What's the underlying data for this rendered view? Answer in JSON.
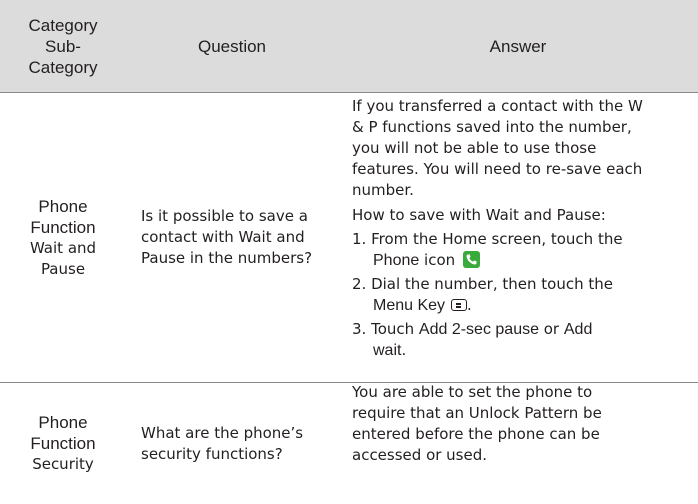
{
  "header": {
    "col1": [
      "Category",
      "Sub-",
      "Category"
    ],
    "col2": "Question",
    "col3": "Answer"
  },
  "rows": [
    {
      "category": "Phone Function",
      "category_lines": [
        "Phone",
        "Function"
      ],
      "subcategory_lines": [
        "Wait and",
        "Pause"
      ],
      "question": "Is it possible to save a contact with Wait and Pause in the numbers?",
      "answer": {
        "para1_lines": [
          "If you transferred a contact with the W",
          "& P functions saved into the number,",
          "you will not be able to use those",
          "features. You will need to re-save each",
          "number."
        ],
        "intro": "How to save with Wait and Pause:",
        "step1_a": "1. From the Home screen, touch the",
        "step1_bold": "Phone",
        "step1_b": " icon ",
        "step1_icon": "phone-icon",
        "step2_a": "2. Dial the number, then touch the",
        "step2_bold": "Menu Key",
        "step2_icon": "menu-key-icon",
        "step2_end": ".",
        "step3_a": "3. Touch ",
        "step3_bold1": "Add 2-sec pause",
        "step3_mid": " or ",
        "step3_bold2": "Add",
        "step3_bold3": "wait",
        "step3_end": "."
      }
    },
    {
      "category": "Phone Function",
      "category_lines": [
        "Phone",
        "Function"
      ],
      "subcategory_lines": [
        "Security"
      ],
      "question": "What are the phone’s security functions?",
      "answer": {
        "lines": [
          "You are able to set the phone to",
          "require that an Unlock Pattern be",
          "entered before the phone can be",
          "accessed or used."
        ]
      }
    }
  ],
  "colors": {
    "header_bg": "#dcdcdc",
    "rule": "#8a8a8a",
    "text": "#231f20",
    "phone_icon_green": "#3aaa3a"
  }
}
